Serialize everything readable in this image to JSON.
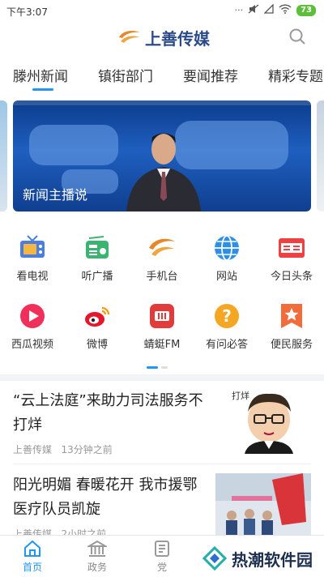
{
  "status_bar": {
    "time": "下午3:07",
    "battery": "73"
  },
  "header": {
    "app_title": "上善传媒"
  },
  "tabs": [
    {
      "label": "滕州新闻"
    },
    {
      "label": "镇街部门"
    },
    {
      "label": "要闻推荐"
    },
    {
      "label": "精彩专题"
    }
  ],
  "banner": {
    "caption": "新闻主播说"
  },
  "grid": [
    {
      "label": "看电视",
      "icon": "tv-icon",
      "color": "#4a7fe0"
    },
    {
      "label": "听广播",
      "icon": "radio-icon",
      "color": "#3cb371"
    },
    {
      "label": "手机台",
      "icon": "brand-logo-icon",
      "color": "#e8862a"
    },
    {
      "label": "网站",
      "icon": "globe-icon",
      "color": "#2f8fe8"
    },
    {
      "label": "今日头条",
      "icon": "toutiao-icon",
      "color": "#f04142"
    },
    {
      "label": "西瓜视频",
      "icon": "xigua-video-icon",
      "color": "#f0305a"
    },
    {
      "label": "微博",
      "icon": "weibo-icon",
      "color": "#e6162d"
    },
    {
      "label": "蜻蜓FM",
      "icon": "qingting-fm-icon",
      "color": "#e23b3b"
    },
    {
      "label": "有问必答",
      "icon": "question-icon",
      "color": "#f5a623"
    },
    {
      "label": "便民服务",
      "icon": "star-badge-icon",
      "color": "#f26b3a"
    }
  ],
  "news": [
    {
      "title": "“云上法庭”来助力司法服务不打烊",
      "source": "上善传媒",
      "time": "13分钟之前"
    },
    {
      "title": "阳光明媚 春暖花开 我市援鄂医疗队员凯旋",
      "source": "上善传媒",
      "time": "2小时之前"
    }
  ],
  "bottom_nav": [
    {
      "label": "首页",
      "icon": "home-icon"
    },
    {
      "label": "政务",
      "icon": "government-icon"
    },
    {
      "label": "党",
      "icon": "party-icon"
    }
  ],
  "watermark": {
    "text": "热潮软件园"
  },
  "colors": {
    "accent": "#2196f3",
    "brand": "#2b4a8a"
  }
}
